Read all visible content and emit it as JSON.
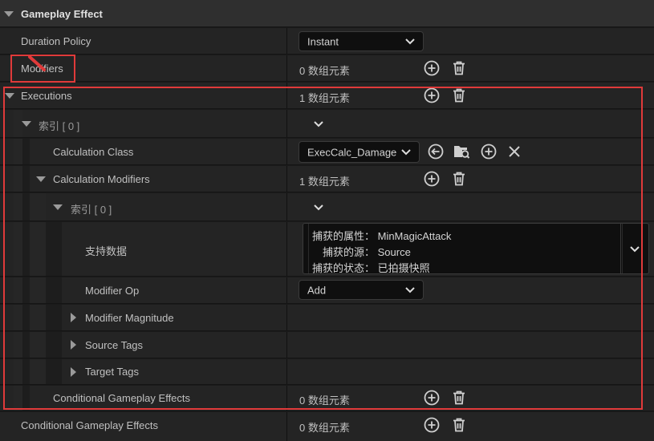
{
  "header": {
    "title": "Gameplay Effect"
  },
  "rows": {
    "duration_policy": {
      "label": "Duration Policy",
      "value": "Instant"
    },
    "modifiers": {
      "label": "Modifiers",
      "value": "0 数组元素"
    },
    "executions": {
      "label": "Executions",
      "value": "1 数组元素"
    },
    "exec_index": {
      "label": "索引 [ 0 ]"
    },
    "calculation_class": {
      "label": "Calculation Class",
      "value": "ExecCalc_Damage"
    },
    "calculation_modifiers": {
      "label": "Calculation Modifiers",
      "value": "1 数组元素"
    },
    "mod_index": {
      "label": "索引 [ 0 ]"
    },
    "backing_data": {
      "label": "支持数据",
      "lines": [
        "捕获的属性： MinMagicAttack",
        "捕获的源： Source",
        "捕获的状态： 已拍摄快照"
      ]
    },
    "modifier_op": {
      "label": "Modifier Op",
      "value": "Add"
    },
    "modifier_magnitude": {
      "label": "Modifier Magnitude"
    },
    "source_tags": {
      "label": "Source Tags"
    },
    "target_tags": {
      "label": "Target Tags"
    },
    "inner_conditional": {
      "label": "Conditional Gameplay Effects",
      "value": "0 数组元素"
    },
    "outer_conditional": {
      "label": "Conditional Gameplay Effects",
      "value": "0 数组元素"
    }
  },
  "icons": [
    "add-circle-icon",
    "trash-icon",
    "back-arrow-icon",
    "browse-folder-icon",
    "clear-x-icon",
    "chevron-down-icon",
    "expand-triangle-icon"
  ],
  "colors": {
    "highlight_border": "#e03a3a",
    "panel_bg": "#242424",
    "field_bg": "#0f0f0f"
  }
}
